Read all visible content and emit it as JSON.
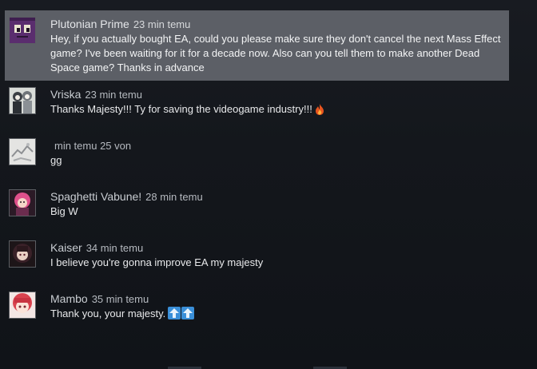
{
  "comments": [
    {
      "author": "Plutonian Prime",
      "time": "23 min temu",
      "text": "Hey, if you actually bought EA, could you please make sure they don't cancel the next Mass Effect game? I've been waiting for it for a decade now. Also can you tell them to make another Dead Space game? Thanks in advance",
      "avatar_icon": "purple-face-avatar",
      "highlighted": true
    },
    {
      "author": "Vriska",
      "time": "23 min temu",
      "text": "Thanks Majesty!!! Ty for saving the videogame industry!!!",
      "avatar_icon": "manga-characters-avatar",
      "emoji": "fire-icon"
    },
    {
      "author": "",
      "time": "min temu 25 von",
      "text": "gg",
      "avatar_icon": "sketch-avatar"
    },
    {
      "author": "Spaghetti Vabune!",
      "time": "28 min temu",
      "text": "Big W",
      "avatar_icon": "pink-hair-avatar"
    },
    {
      "author": "Kaiser",
      "time": "34 min temu",
      "text": "I believe you're gonna improve EA my majesty",
      "avatar_icon": "dark-hair-avatar"
    },
    {
      "author": "Mambo",
      "time": "35 min temu",
      "text": "Thank you, your majesty.",
      "avatar_icon": "red-hair-anime-avatar",
      "emoji": "up-arrow-icons"
    }
  ],
  "colors": {
    "background": "#14171c",
    "highlight": "#5c5f66",
    "text": "#e8e9eb",
    "author": "#c9cdd2"
  }
}
